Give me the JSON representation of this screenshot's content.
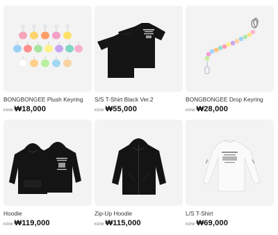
{
  "products": [
    {
      "name": "BONGBONGEE Plush Keyring",
      "currency": "KRW",
      "price": "₩18,000",
      "image_icon": "plush-keyrings-image"
    },
    {
      "name": "S/S T-Shirt Black Ver.2",
      "currency": "KRW",
      "price": "₩55,000",
      "image_icon": "black-tshirt-image"
    },
    {
      "name": "BONGBONGEE Drop Keyring",
      "currency": "KRW",
      "price": "₩28,000",
      "image_icon": "bead-keyring-image"
    },
    {
      "name": "Hoodie",
      "currency": "KRW",
      "price": "₩119,000",
      "image_icon": "black-hoodie-image"
    },
    {
      "name": "Zip-Up Hoodie",
      "currency": "KRW",
      "price": "₩115,000",
      "image_icon": "zip-up-hoodie-image"
    },
    {
      "name": "L/S T-Shirt",
      "currency": "KRW",
      "price": "₩69,000",
      "image_icon": "white-longsleeve-image"
    }
  ],
  "colors": {
    "thumb_bg": "#f3f3f3",
    "garment_black": "#111111",
    "garment_white": "#f7f7f7"
  }
}
